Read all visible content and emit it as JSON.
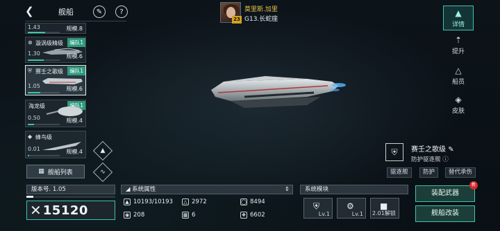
{
  "header": {
    "title": "舰船",
    "back_icon": "back-chevron-icon",
    "edit_icon": "brush-icon",
    "help_icon": "question-icon"
  },
  "commander": {
    "name": "莫里斯.加里",
    "level": "23",
    "location": "G13.长蛇座"
  },
  "ship_list": [
    {
      "name": "",
      "fleet": "",
      "stat": "1.43",
      "scale": "规模.8",
      "bar": 0.55
    },
    {
      "name": "漩涡级精级",
      "fleet": "编队1",
      "stat": "1.30",
      "scale": "规模.6",
      "bar": 0.5
    },
    {
      "name": "赛壬之歌级",
      "fleet": "编队1",
      "stat": "1.05",
      "scale": "规模.6",
      "bar": 0.4,
      "selected": true
    },
    {
      "name": "海龙级",
      "fleet": "编队1",
      "stat": "0.50",
      "scale": "规模.4",
      "bar": 0.2
    },
    {
      "name": "蜂鸟级",
      "fleet": "",
      "stat": "0.01",
      "scale": "规模.4",
      "bar": 0.05
    }
  ],
  "list_button": "舰船列表",
  "right_nav": [
    {
      "label": "详情",
      "icon": "detail-icon",
      "active": true
    },
    {
      "label": "提升",
      "icon": "upgrade-icon"
    },
    {
      "label": "船员",
      "icon": "crew-icon"
    },
    {
      "label": "皮肤",
      "icon": "skin-icon"
    }
  ],
  "ship_info": {
    "class": "赛壬之歌级",
    "role": "防护驱逐舰",
    "tags": [
      "驱逐舰",
      "防护",
      "替代承伤"
    ]
  },
  "version": {
    "label": "版本号. 1.05",
    "progress": 0.08
  },
  "score": "15120",
  "system_attr": {
    "title": "系统属性",
    "items": [
      {
        "icon": "hull-icon",
        "value": "10193/10193"
      },
      {
        "icon": "armor-icon",
        "value": "2972"
      },
      {
        "icon": "shield-icon",
        "value": "8494"
      },
      {
        "icon": "energy-icon",
        "value": "208"
      },
      {
        "icon": "grid-icon",
        "value": "6"
      },
      {
        "icon": "speed-icon",
        "value": "6602"
      }
    ]
  },
  "modules": {
    "title": "系统模块",
    "items": [
      {
        "label": "Lv.1",
        "icon": "module-shield-icon"
      },
      {
        "label": "Lv.1",
        "icon": "module-gear-icon"
      },
      {
        "label": "2.01解锁",
        "icon": "lock-icon",
        "locked": true
      }
    ]
  },
  "actions": {
    "equip": "装配武器",
    "refit": "舰船改装",
    "new_badge": "新"
  },
  "colors": {
    "accent": "#3fc3b0",
    "commander_name": "#e9c24a",
    "badge": "#d62b2b"
  }
}
